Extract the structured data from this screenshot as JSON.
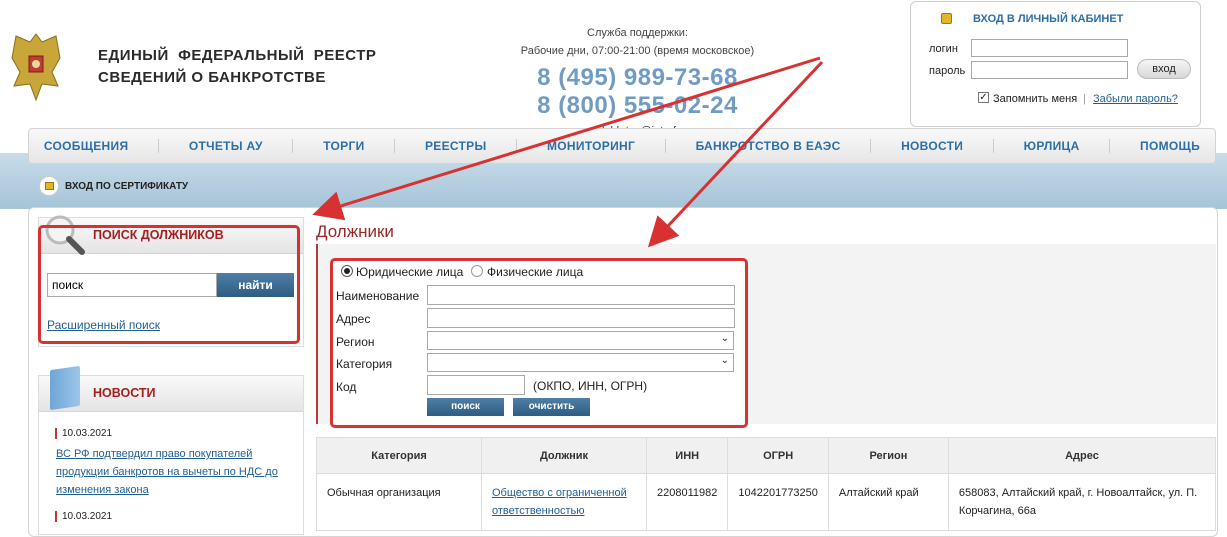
{
  "header": {
    "title_line1": "ЕДИНЫЙ  ФЕДЕРАЛЬНЫЙ  РЕЕСТР",
    "title_line2": "СВЕДЕНИЙ О БАНКРОТСТВЕ"
  },
  "support": {
    "title": "Служба поддержки:",
    "hours": "Рабочие дни, 07:00-21:00 (время московское)",
    "phone1": "8 (495) 989-73-68",
    "phone2": "8 (800) 555-02-24",
    "email_label": "e-mail:",
    "email": "bkrtcp@interfax.ru"
  },
  "login": {
    "title": "ВХОД В ЛИЧНЫЙ КАБИНЕТ",
    "login_label": "логин",
    "password_label": "пароль",
    "submit": "вход",
    "remember": "Запомнить меня",
    "forgot": "Забыли пароль?"
  },
  "nav": [
    "СООБЩЕНИЯ",
    "ОТЧЕТЫ АУ",
    "ТОРГИ",
    "РЕЕСТРЫ",
    "МОНИТОРИНГ",
    "БАНКРОТСТВО В ЕАЭС",
    "НОВОСТИ",
    "ЮРЛИЦА",
    "ПОМОЩЬ"
  ],
  "cert": "ВХОД ПО СЕРТИФИКАТУ",
  "search": {
    "title": "ПОИСК ДОЛЖНИКОВ",
    "value": "поиск",
    "button": "найти",
    "advanced": "Расширенный поиск"
  },
  "news": {
    "title": "НОВОСТИ",
    "items": [
      {
        "date": "10.03.2021",
        "text": "ВС РФ подтвердил право покупателей продукции банкротов на вычеты по НДС до изменения закона"
      },
      {
        "date": "10.03.2021",
        "text": ""
      }
    ]
  },
  "main": {
    "heading": "Должники",
    "radio1": "Юридические лица",
    "radio2": "Физические лица",
    "name_label": "Наименование",
    "address_label": "Адрес",
    "region_label": "Регион",
    "category_label": "Категория",
    "code_label": "Код",
    "code_hint": "(ОКПО, ИНН, ОГРН)",
    "search_btn": "поиск",
    "clear_btn": "очистить"
  },
  "table": {
    "headers": [
      "Категория",
      "Должник",
      "ИНН",
      "ОГРН",
      "Регион",
      "Адрес"
    ],
    "rows": [
      {
        "category": "Обычная организация",
        "debtor": "Общество с ограниченной ответственностью",
        "inn": "2208011982",
        "ogrn": "1042201773250",
        "region": "Алтайский край",
        "address": "658083, Алтайский край, г. Новоалтайск, ул. П. Корчагина, 66а"
      }
    ]
  },
  "colors": {
    "accent": "#2c6ea6",
    "highlight": "#d73131",
    "phone": "#6f9bc4"
  }
}
